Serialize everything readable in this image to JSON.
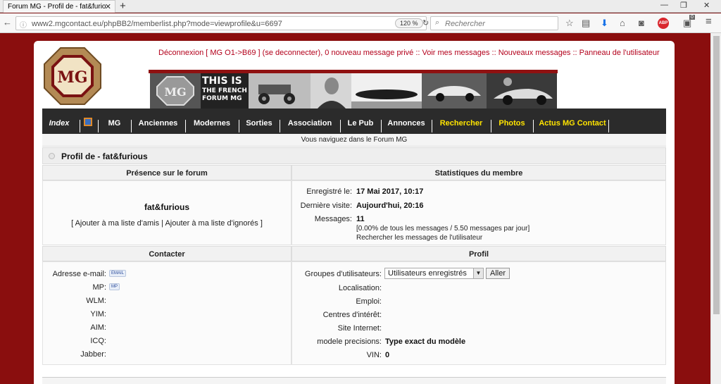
{
  "browser": {
    "tab_title": "Forum MG - Profil de - fat&furio",
    "url": "www2.mgcontact.eu/phpBB2/memberlist.php?mode=viewprofile&u=6697",
    "zoom": "120 %",
    "search_placeholder": "Rechercher",
    "abp_label": "ABP",
    "badge_count": "0"
  },
  "header": {
    "logo_text": "MG",
    "top_links": "Déconnexion [ MG O1->B69 ] (se deconnecter), 0 nouveau message privé :: Voir mes messages :: Nouveaux messages :: Panneau de l'utilisateur",
    "banner_line1": "THIS IS",
    "banner_line2": "THE FRENCH",
    "banner_line3": "FORUM MG"
  },
  "menu": {
    "items": [
      {
        "label": "Index"
      },
      {
        "label": "MG"
      },
      {
        "label": "Anciennes"
      },
      {
        "label": "Modernes"
      },
      {
        "label": "Sorties"
      },
      {
        "label": "Association"
      },
      {
        "label": "Le Pub"
      },
      {
        "label": "Annonces"
      },
      {
        "label": "Rechercher"
      },
      {
        "label": "Photos"
      },
      {
        "label": "Actus MG Contact"
      }
    ]
  },
  "breadcrumb": {
    "prefix": "Vous naviguez dans le",
    "forum": "Forum MG"
  },
  "profile": {
    "title": "Profil de - fat&furious",
    "presence_header": "Présence sur le forum",
    "stats_header": "Statistiques du membre",
    "username": "fat&furious",
    "friend_links": "[ Ajouter à ma liste d'amis | Ajouter à ma liste d'ignorés ]",
    "registered_label": "Enregistré le:",
    "registered_value": "17 Mai 2017, 10:17",
    "last_visit_label": "Dernière visite:",
    "last_visit_value": "Aujourd'hui, 20:16",
    "messages_label": "Messages:",
    "messages_value": "11",
    "messages_detail": "[0.00% de tous les messages / 5.50 messages par jour]",
    "messages_search": "Rechercher les messages de l'utilisateur",
    "contact_header": "Contacter",
    "profile_header": "Profil",
    "contact": {
      "email_label": "Adresse e-mail:",
      "email_btn": "EMAIL",
      "mp_label": "MP:",
      "mp_btn": "MP",
      "wlm_label": "WLM:",
      "yim_label": "YIM:",
      "aim_label": "AIM:",
      "icq_label": "ICQ:",
      "jabber_label": "Jabber:"
    },
    "details": {
      "groups_label": "Groupes d'utilisateurs:",
      "groups_value": "Utilisateurs enregistrés",
      "go_button": "Aller",
      "location_label": "Localisation:",
      "job_label": "Emploi:",
      "interests_label": "Centres d'intérêt:",
      "website_label": "Site Internet:",
      "model_label": "modele precisions:",
      "model_value": "Type exact du modèle",
      "vin_label": "VIN:",
      "vin_value": "0"
    }
  }
}
